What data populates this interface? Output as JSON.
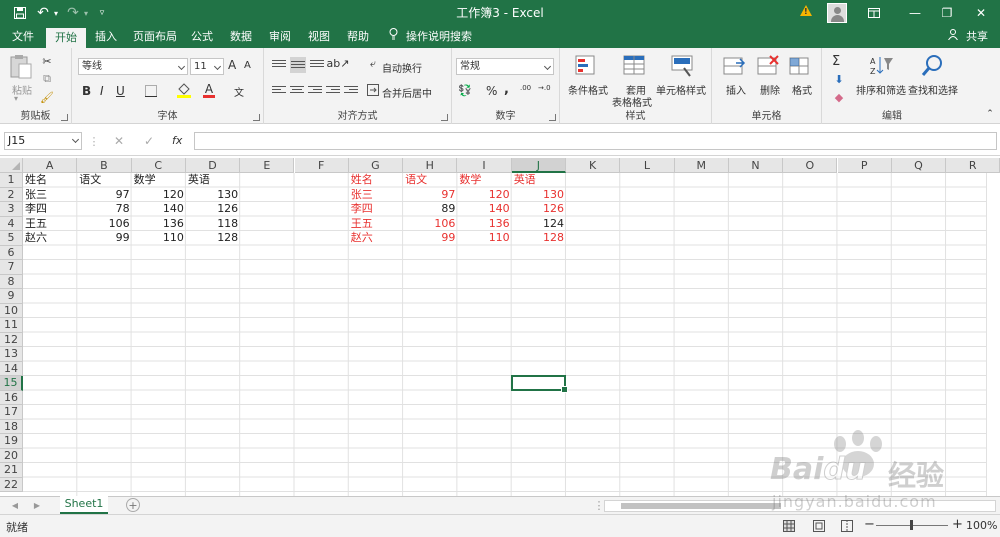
{
  "titlebar": {
    "title": "工作簿3  -  Excel",
    "undo_glyph": "↶",
    "redo_glyph": "↷",
    "warning_glyph": "!",
    "minimize_glyph": "—",
    "restore_glyph": "❐",
    "close_glyph": "✕",
    "icons": [
      "save-icon",
      "undo-icon",
      "redo-icon",
      "customize-qat-icon",
      "warning-icon",
      "avatar",
      "ribbon-display-icon",
      "minimize-icon",
      "restore-icon",
      "close-icon"
    ]
  },
  "tabs": [
    "文件",
    "开始",
    "插入",
    "页面布局",
    "公式",
    "数据",
    "审阅",
    "视图",
    "帮助",
    "操作说明搜索"
  ],
  "share_label": "共享",
  "ribbon": {
    "clipboard": {
      "paste": "粘贴",
      "label": "剪贴板"
    },
    "font": {
      "name": "等线",
      "size": "11",
      "grow": "A",
      "shrink": "A",
      "bold": "B",
      "italic": "I",
      "underline": "U",
      "label": "字体"
    },
    "align": {
      "wrap": "自动换行",
      "merge": "合并后居中",
      "label": "对齐方式"
    },
    "number": {
      "format": "常规",
      "percent": "%",
      "comma": ",",
      "inc_decimal": ".00",
      "dec_decimal": "→.0",
      "label": "数字"
    },
    "styles": {
      "conditional": "条件格式",
      "table1": "套用",
      "table2": "表格格式",
      "cell_styles": "单元格样式",
      "label": "样式"
    },
    "cells": {
      "insert": "插入",
      "delete": "删除",
      "format": "格式",
      "label": "单元格"
    },
    "editing": {
      "sigma": "Σ",
      "sort": "排序和筛选",
      "find": "查找和选择",
      "label": "编辑"
    }
  },
  "formula_bar": {
    "name_box": "J15",
    "cancel": "✕",
    "enter": "✓",
    "fx": "fx",
    "value": ""
  },
  "columns": [
    "A",
    "B",
    "C",
    "D",
    "E",
    "F",
    "G",
    "H",
    "I",
    "J",
    "K",
    "L",
    "M",
    "N",
    "O",
    "P",
    "Q",
    "R"
  ],
  "rows": [
    "1",
    "2",
    "3",
    "4",
    "5",
    "6",
    "7",
    "8",
    "9",
    "10",
    "11",
    "12",
    "13",
    "14",
    "15",
    "16",
    "17",
    "18",
    "19",
    "20",
    "21",
    "22"
  ],
  "selected": {
    "col": "J",
    "row": "15"
  },
  "table_black": {
    "headers": [
      "姓名",
      "语文",
      "数学",
      "英语"
    ],
    "rows": [
      [
        "张三",
        "97",
        "120",
        "130"
      ],
      [
        "李四",
        "78",
        "140",
        "126"
      ],
      [
        "王五",
        "106",
        "136",
        "118"
      ],
      [
        "赵六",
        "99",
        "110",
        "128"
      ]
    ]
  },
  "table_red": {
    "headers": [
      "姓名",
      "语文",
      "数学",
      "英语"
    ],
    "rows": [
      [
        "张三",
        "97",
        "120",
        "130"
      ],
      [
        "李四",
        "89",
        "140",
        "126"
      ],
      [
        "王五",
        "106",
        "136",
        "124"
      ],
      [
        "赵六",
        "99",
        "110",
        "128"
      ]
    ],
    "black_cells": [
      [
        1,
        1
      ],
      [
        2,
        3
      ]
    ]
  },
  "sheet_tab": "Sheet1",
  "add_sheet": "+",
  "status": {
    "ready": "就绪",
    "zoom": "100%",
    "zoom_minus": "−",
    "zoom_plus": "+"
  },
  "watermark": {
    "brand": "Bai",
    "brand2": "du",
    "cn": "经验",
    "url": "jingyan.baidu.com"
  },
  "colors": {
    "accent": "#217346",
    "red_text": "#e8312f",
    "ribbon_bg": "#f3f3f3"
  }
}
